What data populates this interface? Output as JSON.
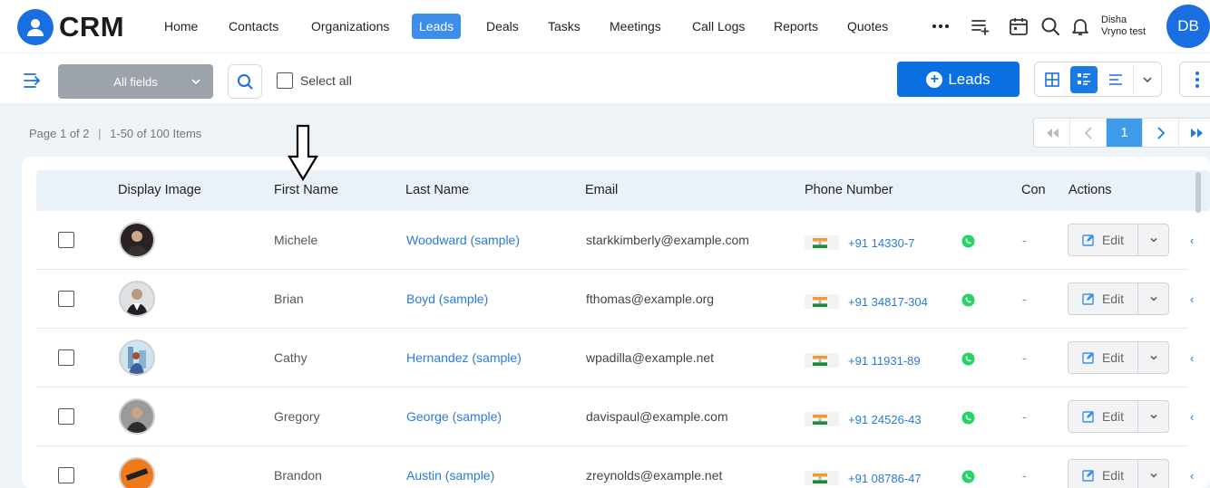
{
  "app": {
    "name": "CRM"
  },
  "nav": {
    "items": [
      "Home",
      "Contacts",
      "Organizations",
      "Leads",
      "Deals",
      "Tasks",
      "Meetings",
      "Call Logs",
      "Reports",
      "Quotes"
    ],
    "active": "Leads",
    "more_icon": "more-horizontal-icon"
  },
  "user": {
    "first": "Disha",
    "second": "Vryno test",
    "initials": "DB"
  },
  "toolbar": {
    "field_select": "All fields",
    "select_all": "Select all",
    "add_button": "Leads"
  },
  "pagination": {
    "page_text": "Page 1 of 2",
    "items_text": "1-50 of 100 Items",
    "current_page": "1"
  },
  "table": {
    "headers": [
      "Display Image",
      "First Name",
      "Last Name",
      "Email",
      "Phone Number",
      "Con",
      "Actions"
    ],
    "edit_label": "Edit",
    "rows": [
      {
        "first": "Michele",
        "last": "Woodward (sample)",
        "email": "starkkimberly@example.com",
        "phone": "+91 14330-7",
        "company": "-"
      },
      {
        "first": "Brian",
        "last": "Boyd (sample)",
        "email": "fthomas@example.org",
        "phone": "+91 34817-304",
        "company": "-"
      },
      {
        "first": "Cathy",
        "last": "Hernandez (sample)",
        "email": "wpadilla@example.net",
        "phone": "+91 11931-89",
        "company": "-"
      },
      {
        "first": "Gregory",
        "last": "George (sample)",
        "email": "davispaul@example.com",
        "phone": "+91 24526-43",
        "company": "-"
      },
      {
        "first": "Brandon",
        "last": "Austin (sample)",
        "email": "zreynolds@example.net",
        "phone": "+91 08786-47",
        "company": "-"
      }
    ]
  },
  "colors": {
    "brand": "#1a6fe0",
    "accent": "#3d8ee8",
    "link": "#2a7bd9",
    "whatsapp": "#25d366"
  }
}
